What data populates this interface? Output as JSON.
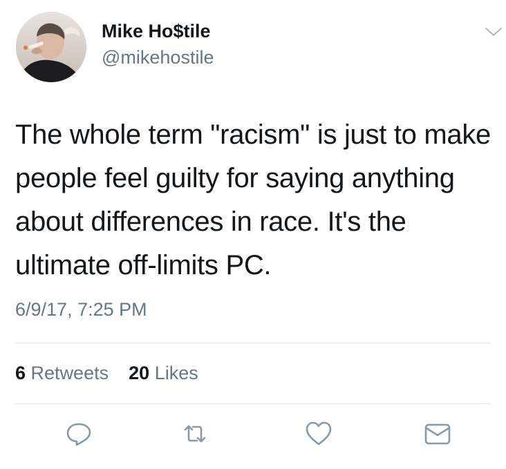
{
  "author": {
    "display_name": "Mike Ho$tile",
    "handle": "@mikehostile"
  },
  "tweet": {
    "text": "The whole term \"racism\" is just to make people feel guilty for saying anything about differences in race. It's the ultimate off-limits PC.",
    "timestamp": "6/9/17, 7:25 PM"
  },
  "stats": {
    "retweets_count": "6",
    "retweets_label": "Retweets",
    "likes_count": "20",
    "likes_label": "Likes"
  },
  "actions": {
    "reply_icon": "reply-icon",
    "retweet_icon": "retweet-icon",
    "like_icon": "heart-icon",
    "dm_icon": "envelope-icon"
  },
  "colors": {
    "text": "#14171a",
    "secondary": "#657786",
    "divider": "#dfe3e6",
    "icon": "#8899a6"
  }
}
